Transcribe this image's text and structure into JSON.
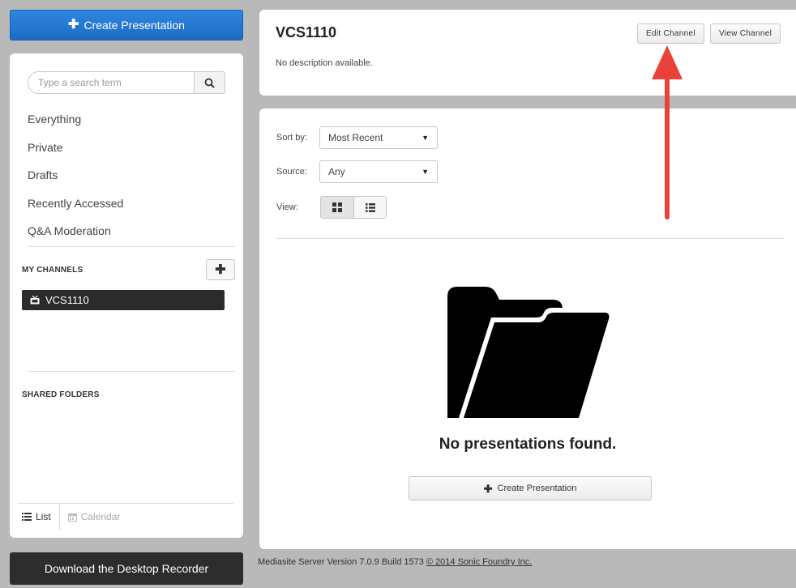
{
  "sidebar": {
    "create_label": "Create Presentation",
    "search_placeholder": "Type a search term",
    "nav_items": [
      "Everything",
      "Private",
      "Drafts",
      "Recently Accessed",
      "Q&A Moderation"
    ],
    "my_channels_title": "MY CHANNELS",
    "channels": [
      "VCS1110"
    ],
    "shared_folders_title": "SHARED FOLDERS",
    "view_tabs": {
      "list": "List",
      "calendar": "Calendar"
    },
    "recorder_label": "Download the Desktop Recorder"
  },
  "header": {
    "title": "VCS1110",
    "description": "No description available.",
    "edit_label": "Edit Channel",
    "view_label": "View Channel"
  },
  "content": {
    "sort_label": "Sort by:",
    "sort_value": "Most Recent",
    "source_label": "Source:",
    "source_value": "Any",
    "view_label": "View:",
    "empty_message": "No presentations found.",
    "create_label": "Create Presentation"
  },
  "footer": {
    "version_text": "Mediasite Server Version 7.0.9 Build 1573",
    "copyright_link": "© 2014 Sonic Foundry Inc."
  },
  "colors": {
    "primary_blue": "#1c6bc4",
    "dark": "#2b2b2b",
    "annotation_red": "#e8423a"
  }
}
